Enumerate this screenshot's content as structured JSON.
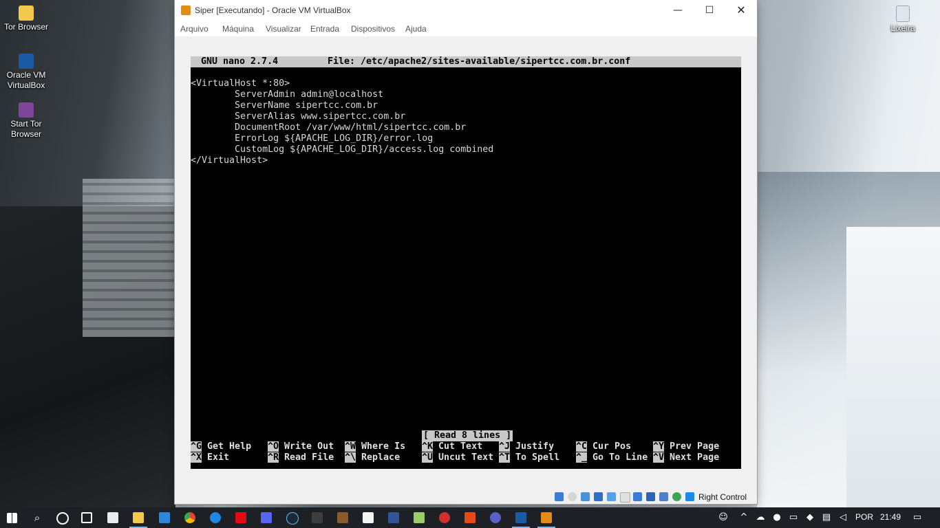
{
  "desktop": {
    "icons_left": [
      {
        "label": "Tor Browser",
        "icon": "folder-icon"
      },
      {
        "label": "Oracle VM VirtualBox",
        "icon": "virtualbox-icon"
      },
      {
        "label": "Start Tor Browser",
        "icon": "tor-icon"
      }
    ],
    "icon_right": {
      "label": "Lixeira",
      "icon": "recycle-bin-icon"
    }
  },
  "window": {
    "title": "Siper [Executando] - Oracle VM VirtualBox",
    "buttons": {
      "minimize": "—",
      "maximize": "☐",
      "close": "✕"
    },
    "menu": [
      "Arquivo",
      "Máquina",
      "Visualizar",
      "Entrada",
      "Dispositivos",
      "Ajuda"
    ],
    "host_key": "Right Control"
  },
  "nano": {
    "version": "GNU nano 2.7.4",
    "file": "File: /etc/apache2/sites-available/sipertcc.com.br.conf",
    "lines": [
      "<VirtualHost *:80>",
      "        ServerAdmin admin@localhost",
      "        ServerName sipertcc.com.br",
      "        ServerAlias www.sipertcc.com.br",
      "        DocumentRoot /var/www/html/sipertcc.com.br",
      "        ErrorLog ${APACHE_LOG_DIR}/error.log",
      "        CustomLog ${APACHE_LOG_DIR}/access.log combined",
      "</VirtualHost>"
    ],
    "status": "[ Read 8 lines ]",
    "shortcuts_row1": [
      {
        "key": "^G",
        "label": "Get Help"
      },
      {
        "key": "^O",
        "label": "Write Out"
      },
      {
        "key": "^W",
        "label": "Where Is"
      },
      {
        "key": "^K",
        "label": "Cut Text"
      },
      {
        "key": "^J",
        "label": "Justify"
      },
      {
        "key": "^C",
        "label": "Cur Pos"
      },
      {
        "key": "^Y",
        "label": "Prev Page"
      }
    ],
    "shortcuts_row2": [
      {
        "key": "^X",
        "label": "Exit"
      },
      {
        "key": "^R",
        "label": "Read File"
      },
      {
        "key": "^\\",
        "label": "Replace"
      },
      {
        "key": "^U",
        "label": "Uncut Text"
      },
      {
        "key": "^T",
        "label": "To Spell"
      },
      {
        "key": "^_",
        "label": "Go To Line"
      },
      {
        "key": "^V",
        "label": "Next Page"
      }
    ]
  },
  "taskbar": {
    "language": "POR",
    "time": "21:49",
    "colors": {
      "background": "#1d2126",
      "active": "#7fb6e6"
    }
  }
}
